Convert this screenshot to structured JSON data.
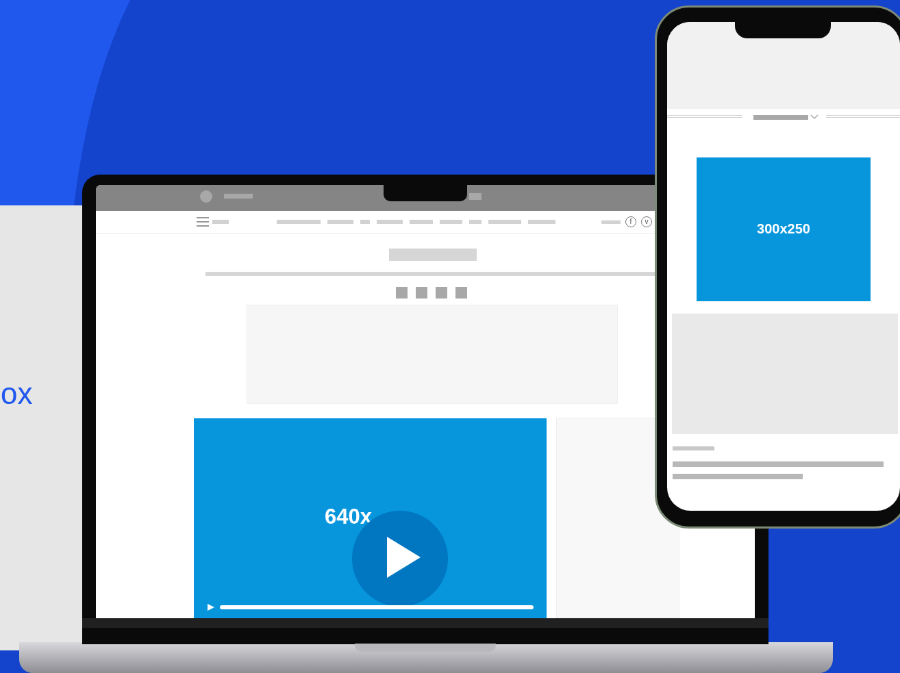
{
  "side_text": "ox",
  "laptop": {
    "social_icons": [
      "f",
      "v"
    ],
    "video_ad": {
      "label": "640x"
    }
  },
  "phone": {
    "banner_ad": {
      "label": "300x250"
    }
  }
}
